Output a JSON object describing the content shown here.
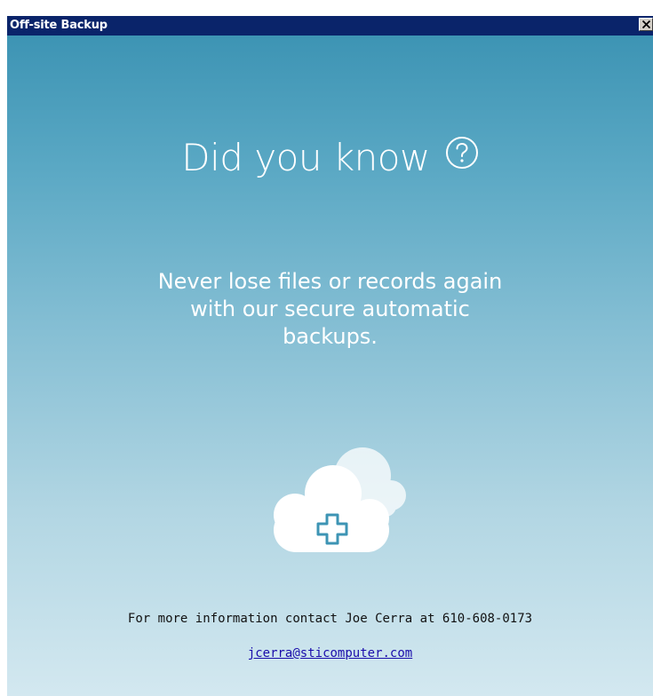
{
  "window": {
    "title": "Off-site Backup"
  },
  "content": {
    "heading": "Did you know",
    "message_lines": [
      "Never lose files or records again",
      "with our secure automatic",
      "backups."
    ],
    "contact_text": "For more information contact Joe Cerra at 610-608-0173",
    "email": "jcerra@sticomputer.com"
  },
  "icons": {
    "close": "close-icon",
    "question": "question-circle-icon",
    "cloud": "cloud-plus-icon"
  },
  "colors": {
    "titlebar": "#0a246a",
    "gradient_top": "#3d94b4",
    "gradient_bottom": "#d3e8f0",
    "link": "#1a0dab"
  }
}
